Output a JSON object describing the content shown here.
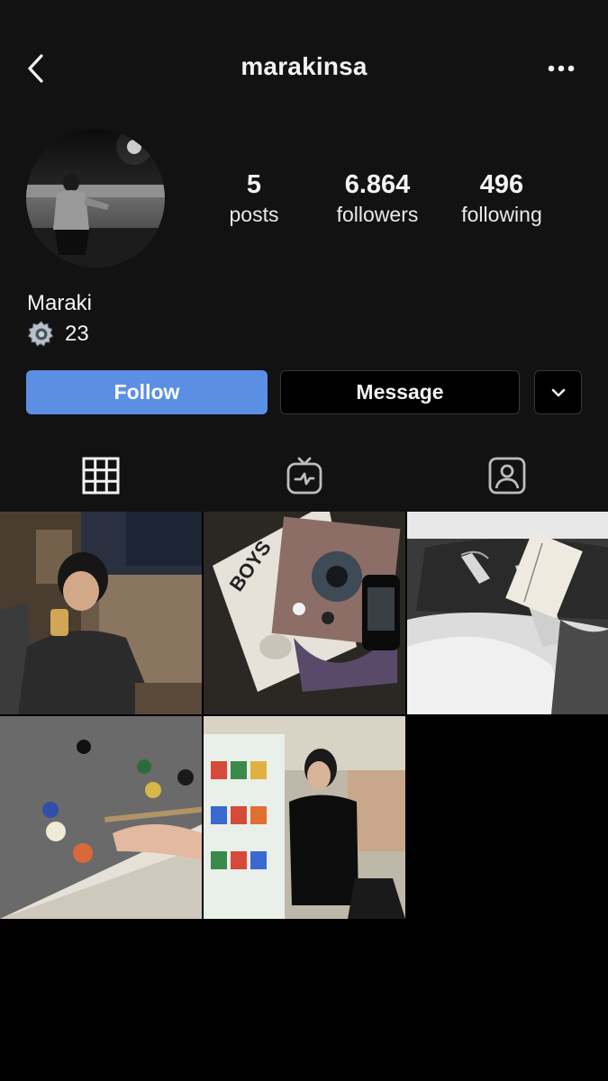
{
  "header": {
    "username": "marakinsa",
    "back_icon": "chevron-left-icon",
    "more_icon": "more-horizontal-icon"
  },
  "profile": {
    "avatar_icon": "profile-photo",
    "display_name": "Maraki",
    "bio_emoji_icon": "gear-icon",
    "bio_text": "23"
  },
  "stats": {
    "posts": {
      "value": "5",
      "label": "posts"
    },
    "followers": {
      "value": "6.864",
      "label": "followers"
    },
    "following": {
      "value": "496",
      "label": "following"
    }
  },
  "actions": {
    "follow_label": "Follow",
    "message_label": "Message",
    "dropdown_icon": "chevron-down-icon"
  },
  "tabs": [
    {
      "icon": "grid-icon",
      "active": true
    },
    {
      "icon": "igtv-icon",
      "active": false
    },
    {
      "icon": "tagged-person-icon",
      "active": false
    }
  ],
  "posts": [
    {
      "description": "man drinking beer in bar"
    },
    {
      "description": "record and handheld console"
    },
    {
      "description": "smoking while reading book"
    },
    {
      "description": "billiard table with balls"
    },
    {
      "description": "man standing by vending machine"
    }
  ],
  "colors": {
    "background": "#121212",
    "accent_follow": "#5b8fe3",
    "text": "#f2f2f2"
  }
}
